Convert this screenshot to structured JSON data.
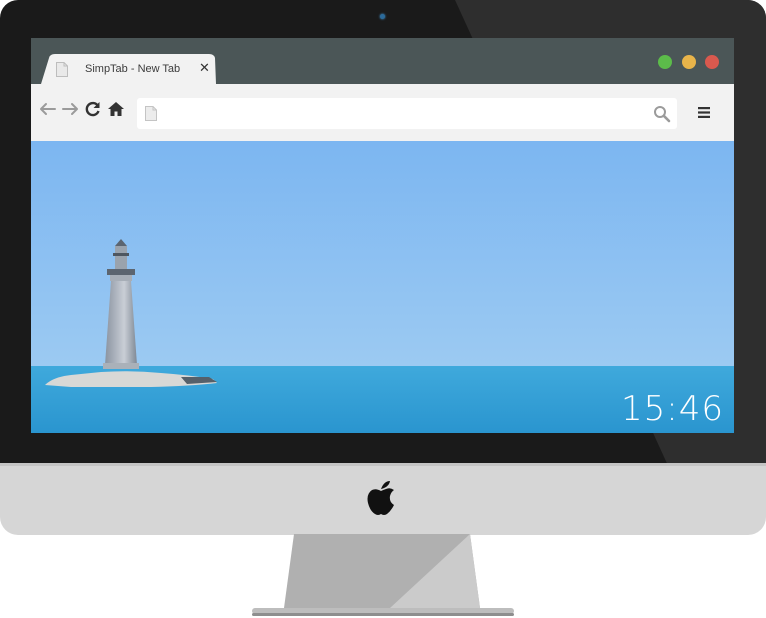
{
  "browser": {
    "tab": {
      "title": "SimpTab - New Tab",
      "close_glyph": "✕"
    },
    "window_controls": [
      {
        "name": "minimize",
        "color": "#5cbc4a"
      },
      {
        "name": "zoom",
        "color": "#e8b44a"
      },
      {
        "name": "close",
        "color": "#d9594e"
      }
    ],
    "toolbar": {
      "back_icon": "arrow-left-icon",
      "forward_icon": "arrow-right-icon",
      "reload_icon": "reload-icon",
      "home_icon": "home-icon",
      "omnibox": {
        "value": "",
        "placeholder": ""
      },
      "search_icon": "search-icon",
      "menu_icon": "hamburger-menu-icon"
    }
  },
  "page": {
    "clock": "15:46",
    "wallpaper": "lighthouse-on-rocky-islet-at-sea"
  },
  "colors": {
    "frame": "#1a1a1a",
    "chin": "#d6d6d6",
    "tabbar": "#4b5657",
    "toolbar": "#f2f2f2",
    "sky_top": "#7fb8f2",
    "sea": "#2a9ed6"
  }
}
